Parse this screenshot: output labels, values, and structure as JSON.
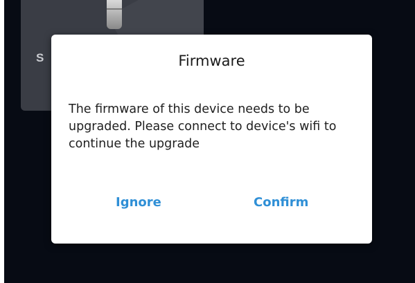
{
  "background": {
    "card_text": "S"
  },
  "dialog": {
    "title": "Firmware",
    "message": "The firmware of this device needs to be upgraded. Please connect to device's wifi to continue the upgrade",
    "ignore_label": "Ignore",
    "confirm_label": "Confirm"
  },
  "colors": {
    "button_accent": "#2f8fd6",
    "overlay_background": "#070b14",
    "dialog_background": "#ffffff"
  }
}
